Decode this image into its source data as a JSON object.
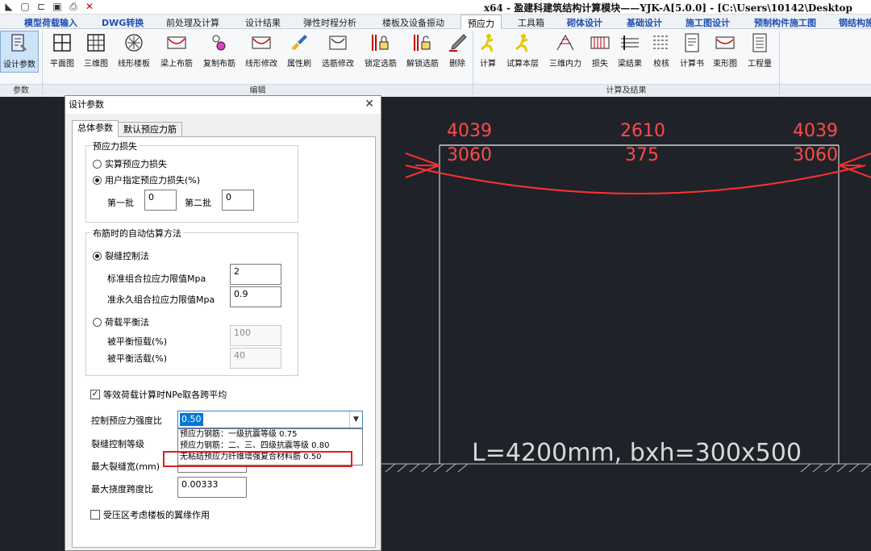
{
  "window": {
    "title": "x64 - 盈建科建筑结构计算模块——YJK-A[5.0.0] - [C:\\Users\\10142\\Desktop"
  },
  "quick_access": [
    "menu-icon",
    "new-file-icon",
    "open-folder-icon",
    "save-icon",
    "print-icon",
    "close-file-icon"
  ],
  "tabs": [
    {
      "label": "模型荷载输入",
      "style": "blue"
    },
    {
      "label": "DWG转换",
      "style": "blue"
    },
    {
      "label": "前处理及计算",
      "style": "normal"
    },
    {
      "label": "设计结果",
      "style": "normal"
    },
    {
      "label": "弹性时程分析",
      "style": "normal"
    },
    {
      "label": "楼板及设备振动",
      "style": "normal"
    },
    {
      "label": "预应力",
      "style": "active"
    },
    {
      "label": "工具箱",
      "style": "normal"
    },
    {
      "label": "砌体设计",
      "style": "blue"
    },
    {
      "label": "基础设计",
      "style": "blue"
    },
    {
      "label": "施工图设计",
      "style": "blue"
    },
    {
      "label": "预制构件施工图",
      "style": "blue"
    },
    {
      "label": "钢结构施",
      "style": "blue"
    }
  ],
  "ribbon": {
    "buttons": [
      {
        "label": "设计参数",
        "icon": "design-params-icon"
      },
      {
        "label": "平面图",
        "icon": "plan-grid-icon"
      },
      {
        "label": "三维图",
        "icon": "3d-grid-icon"
      },
      {
        "label": "线形楼板",
        "icon": "slab-line-icon"
      },
      {
        "label": "梁上布筋",
        "icon": "beam-rebar-icon"
      },
      {
        "label": "复制布筋",
        "icon": "copy-rebar-icon"
      },
      {
        "label": "线形修改",
        "icon": "line-edit-icon"
      },
      {
        "label": "属性刷",
        "icon": "brush-icon"
      },
      {
        "label": "选筋修改",
        "icon": "rebar-select-edit-icon"
      },
      {
        "label": "锁定选筋",
        "icon": "lock-rebar-icon"
      },
      {
        "label": "解锁选筋",
        "icon": "unlock-rebar-icon"
      },
      {
        "label": "删除",
        "icon": "delete-pen-icon"
      },
      {
        "label": "计算",
        "icon": "run-calc-icon"
      },
      {
        "label": "试算本层",
        "icon": "trial-calc-icon"
      },
      {
        "label": "三维内力",
        "icon": "3d-force-icon"
      },
      {
        "label": "损失",
        "icon": "loss-icon"
      },
      {
        "label": "梁结果",
        "icon": "beam-result-icon"
      },
      {
        "label": "校核",
        "icon": "check-icon"
      },
      {
        "label": "计算书",
        "icon": "report-icon"
      },
      {
        "label": "束形图",
        "icon": "tendon-shape-icon"
      },
      {
        "label": "工程量",
        "icon": "quantity-icon"
      }
    ],
    "groups": [
      "参数",
      "编辑",
      "计算及结果"
    ]
  },
  "dialog": {
    "title": "设计参数",
    "close_glyph": "✕",
    "tabs": [
      "总体参数",
      "默认预应力筋"
    ],
    "loss_group": {
      "title": "预应力损失",
      "opt_actual": "实算预应力损失",
      "opt_user": "用户指定预应力损失(%)",
      "batch1_label": "第一批",
      "batch1_value": "0",
      "batch2_label": "第二批",
      "batch2_value": "0"
    },
    "method_group": {
      "title": "布筋时的自动估算方法",
      "opt_crack": "裂缝控制法",
      "std_label": "标准组合拉应力限值Mpa",
      "std_value": "2",
      "quasi_label": "准永久组合拉应力限值Mpa",
      "quasi_value": "0.9",
      "opt_balance": "荷载平衡法",
      "dead_label": "被平衡恒载(%)",
      "dead_value": "100",
      "live_label": "被平衡活载(%)",
      "live_value": "40"
    },
    "npe_check": "等效荷载计算时NPe取各跨平均",
    "ctrl_label": "控制预应力强度比",
    "ctrl_value": "0.50",
    "dropdown_options": [
      "预应力钢筋：一级抗震等级 0.75",
      "预应力钢筋：二、三、四级抗震等级 0.80",
      "无粘结预应力纤维增强复合材料筋 0.50"
    ],
    "crack_grade_label": "裂缝控制等级",
    "max_crack_label": "最大裂缝宽(mm)",
    "deflection_label": "最大挠度跨度比",
    "deflection_value": "0.00333",
    "flange_check": "受压区考虑楼板的翼缘作用"
  },
  "canvas": {
    "top_left": "4039",
    "top_mid": "2610",
    "top_right": "4039",
    "low_left": "3060",
    "low_mid": "375",
    "low_right": "3060",
    "beam_caption": "L=4200mm, bxh=300x500"
  },
  "colors": {
    "canvas_bg": "#1f2329",
    "dim_red": "#ff4a4a",
    "ribbon_blue_tab": "#2050b0",
    "selection_blue": "#0078d7",
    "highlight_red": "#e02020"
  }
}
